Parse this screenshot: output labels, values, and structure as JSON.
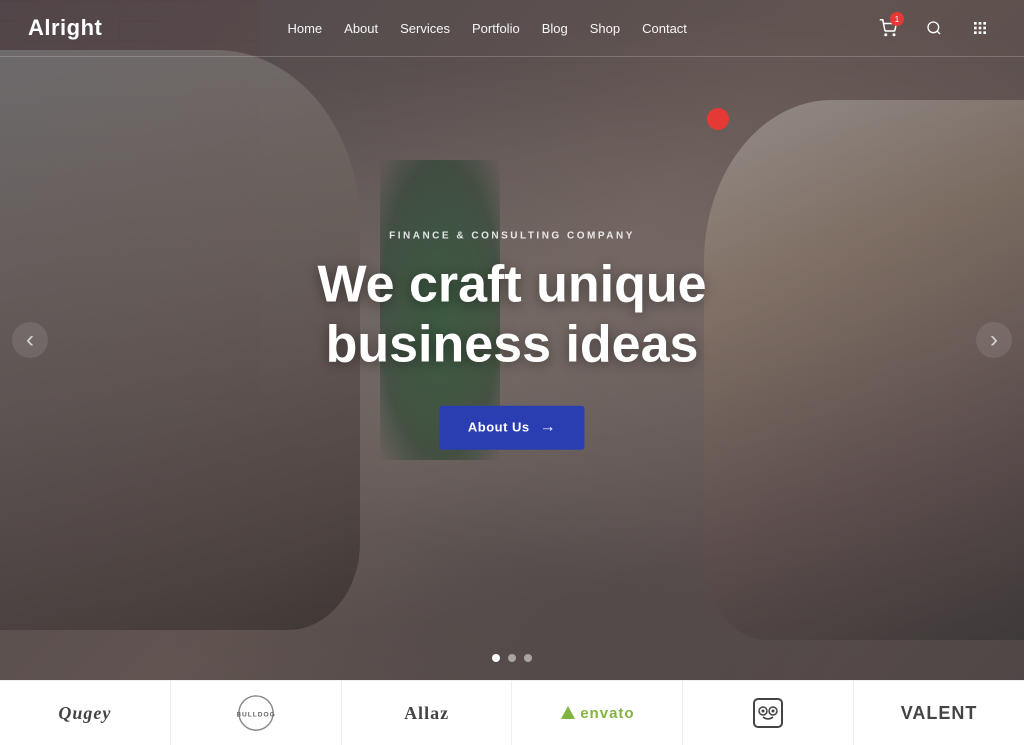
{
  "header": {
    "logo": "Alright",
    "nav": {
      "items": [
        {
          "label": "Home",
          "active": true
        },
        {
          "label": "About"
        },
        {
          "label": "Services"
        },
        {
          "label": "Portfolio"
        },
        {
          "label": "Blog"
        },
        {
          "label": "Shop"
        },
        {
          "label": "Contact"
        }
      ]
    },
    "icons": {
      "cart_count": "1",
      "search_label": "search",
      "grid_label": "menu"
    }
  },
  "hero": {
    "subtitle": "Finance & Consulting Company",
    "title_line1": "We craft unique",
    "title_line2": "business ideas",
    "cta_label": "About Us",
    "cta_arrow": "→",
    "prev_arrow": "‹",
    "next_arrow": "›",
    "dots": [
      {
        "active": true
      },
      {
        "active": false
      },
      {
        "active": false
      }
    ]
  },
  "logos": [
    {
      "text": "Qugey",
      "style": "qugey"
    },
    {
      "text": "BULLDOG",
      "style": "bulldog"
    },
    {
      "text": "Allaz",
      "style": "allaz"
    },
    {
      "text": "◆envato",
      "style": "envato"
    },
    {
      "text": "🦉",
      "style": "owl"
    },
    {
      "text": "VALENT",
      "style": "valent"
    }
  ]
}
